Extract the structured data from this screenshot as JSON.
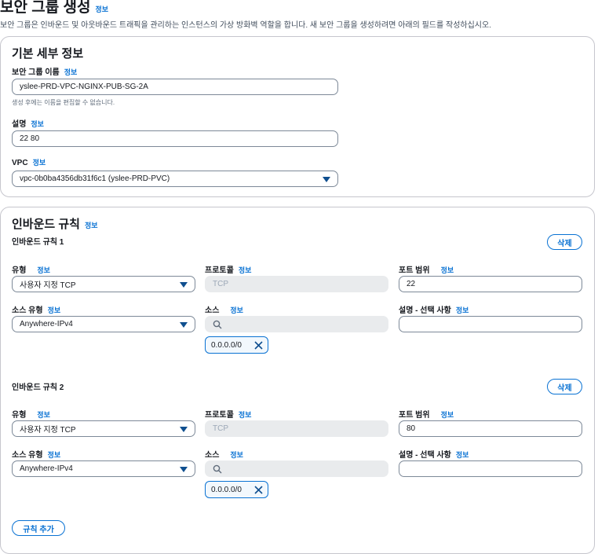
{
  "page": {
    "title": "보안 그룹 생성",
    "info": "정보",
    "description": "보안 그룹은 인바운드 및 아웃바운드 트래픽을 관리하는 인스턴스의 가상 방화벽 역할을 합니다. 새 보안 그룹을 생성하려면 아래의 필드를 작성하십시오."
  },
  "basic": {
    "heading": "기본 세부 정보",
    "name_label": "보안 그룹 이름",
    "name_value": "yslee-PRD-VPC-NGINX-PUB-SG-2A",
    "name_hint": "생성 후에는 이름을 편집할 수 없습니다.",
    "desc_label": "설명",
    "desc_value": "22 80",
    "vpc_label": "VPC",
    "vpc_value": "vpc-0b0ba4356db31f6c1 (yslee-PRD-PVC)"
  },
  "inbound": {
    "heading": "인바운드 규칙",
    "add_rule": "규칙 추가",
    "labels": {
      "type": "유형",
      "protocol": "프로토콜",
      "port": "포트 범위",
      "source_type": "소스 유형",
      "source": "소스",
      "desc": "설명 - 선택 사항",
      "delete": "삭제"
    },
    "rules": [
      {
        "title": "인바운드 규칙 1",
        "type": "사용자 지정 TCP",
        "protocol": "TCP",
        "port": "22",
        "source_type": "Anywhere-IPv4",
        "token": "0.0.0.0/0"
      },
      {
        "title": "인바운드 규칙 2",
        "type": "사용자 지정 TCP",
        "protocol": "TCP",
        "port": "80",
        "source_type": "Anywhere-IPv4",
        "token": "0.0.0.0/0"
      }
    ]
  },
  "icons": {
    "search": "search-icon",
    "remove": "close-icon",
    "dropdown": "caret-down-icon"
  },
  "colors": {
    "link": "#0972d3",
    "border": "#7d8998",
    "disabled": "#e9ebed"
  }
}
